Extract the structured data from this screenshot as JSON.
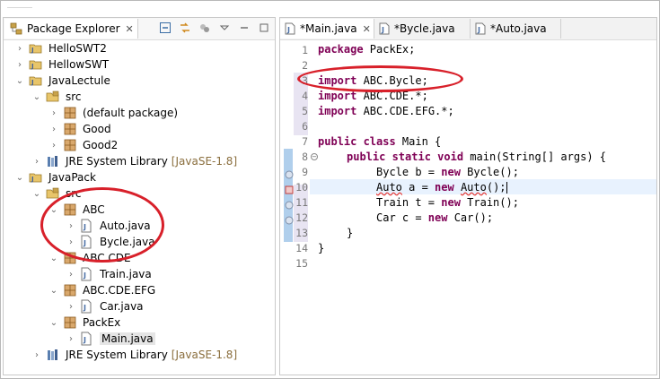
{
  "explorer": {
    "title": "Package Explorer",
    "items": [
      {
        "label": "HelloSWT2",
        "type": "project"
      },
      {
        "label": "HellowSWT",
        "type": "project"
      },
      {
        "label": "JavaLectule",
        "type": "project"
      },
      {
        "label": "src",
        "type": "folder"
      },
      {
        "label": "(default package)",
        "type": "package"
      },
      {
        "label": "Good",
        "type": "package"
      },
      {
        "label": "Good2",
        "type": "package"
      },
      {
        "label": "JRE System Library",
        "suffix": "[JavaSE-1.8]",
        "type": "library"
      },
      {
        "label": "JavaPack",
        "type": "project"
      },
      {
        "label": "src",
        "type": "folder"
      },
      {
        "label": "ABC",
        "type": "package"
      },
      {
        "label": "Auto.java",
        "type": "file"
      },
      {
        "label": "Bycle.java",
        "type": "file"
      },
      {
        "label": "ABC.CDE",
        "type": "package"
      },
      {
        "label": "Train.java",
        "type": "file"
      },
      {
        "label": "ABC.CDE.EFG",
        "type": "package"
      },
      {
        "label": "Car.java",
        "type": "file"
      },
      {
        "label": "PackEx",
        "type": "package"
      },
      {
        "label": "Main.java",
        "type": "file"
      },
      {
        "label": "JRE System Library",
        "suffix": "[JavaSE-1.8]",
        "type": "library"
      }
    ]
  },
  "editor": {
    "tabs": [
      "*Main.java",
      "*Bycle.java",
      "*Auto.java"
    ],
    "line_numbers": [
      "1",
      "2",
      "3",
      "4",
      "5",
      "6",
      "7",
      "8",
      "9",
      "10",
      "11",
      "12",
      "13",
      "14",
      "15"
    ],
    "lines": {
      "l1_kw": "package",
      "l1": " PackEx;",
      "l3_kw": "import",
      "l3": " ABC.Bycle;",
      "l4_kw": "import",
      "l4": " ABC.CDE.*;",
      "l5_kw": "import",
      "l5": " ABC.CDE.EFG.*;",
      "l7_kw": "public class",
      "l7": " Main {",
      "l8_kw": "public static void",
      "l8": " main(String[] args) {",
      "l9a": "Bycle b = ",
      "l9_kw": "new",
      "l9b": " Bycle();",
      "l10a": "Auto",
      "l10b": " a = ",
      "l10_kw": "new",
      "l10c": " ",
      "l10d": "Auto",
      "l10e": "();",
      "l11a": "Train t = ",
      "l11_kw": "new",
      "l11b": " Train();",
      "l12a": "Car c = ",
      "l12_kw": "new",
      "l12b": " Car();",
      "l13": "}",
      "l14": "}"
    }
  },
  "colors": {
    "keyword": "#7f0055",
    "annotation_red": "#d8202a",
    "current_line": "#e8f2fe"
  }
}
